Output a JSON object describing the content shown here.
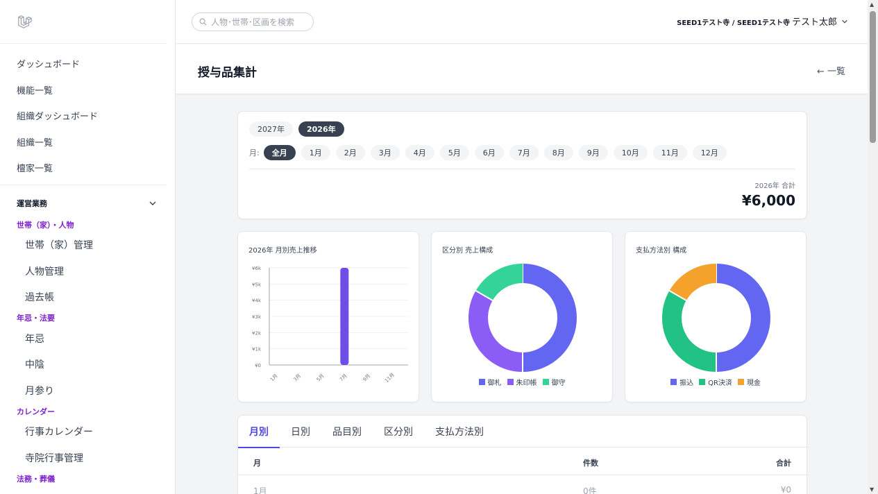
{
  "sidebar": {
    "items": [
      "ダッシュボード",
      "機能一覧",
      "組織ダッシュボード",
      "組織一覧",
      "檀家一覧"
    ],
    "group": "運営業務",
    "sections": [
      {
        "title": "世帯（家）・人物",
        "items": [
          "世帯（家）管理",
          "人物管理",
          "過去帳"
        ]
      },
      {
        "title": "年忌・法要",
        "items": [
          "年忌",
          "中陰",
          "月参り"
        ]
      },
      {
        "title": "カレンダー",
        "items": [
          "行事カレンダー",
          "寺院行事管理"
        ]
      },
      {
        "title": "法務・葬儀",
        "items": []
      }
    ]
  },
  "topbar": {
    "search_placeholder": "人物･世帯･区画を検索",
    "org": "SEED1テスト寺 / SEED1テスト寺",
    "user": "テスト太郎"
  },
  "page": {
    "title": "授与品集計",
    "back": "← 一覧"
  },
  "filters": {
    "years": [
      "2027年",
      "2026年"
    ],
    "active_year": "2026年",
    "month_label": "月:",
    "months": [
      "全月",
      "1月",
      "2月",
      "3月",
      "4月",
      "5月",
      "6月",
      "7月",
      "8月",
      "9月",
      "10月",
      "11月",
      "12月"
    ],
    "active_month": "全月"
  },
  "summary": {
    "label": "2026年 合計",
    "value": "¥6,000"
  },
  "chart_data": [
    {
      "type": "bar",
      "title": "2026年 月別売上推移",
      "categories": [
        "1月",
        "2月",
        "3月",
        "4月",
        "5月",
        "6月",
        "7月",
        "8月",
        "9月",
        "10月",
        "11月",
        "12月"
      ],
      "x_tick_labels": [
        "1月",
        "3月",
        "5月",
        "7月",
        "9月",
        "11月"
      ],
      "values": [
        0,
        0,
        0,
        0,
        0,
        0,
        6000,
        0,
        0,
        0,
        0,
        0
      ],
      "y_tick_labels": [
        "¥0",
        "¥1k",
        "¥2k",
        "¥3k",
        "¥4k",
        "¥5k",
        "¥6k"
      ],
      "ylim": [
        0,
        6000
      ],
      "color": "#6d4ee6",
      "grid": true
    },
    {
      "type": "pie",
      "title": "区分別 売上構成",
      "labels": [
        "御札",
        "朱印帳",
        "御守"
      ],
      "values": [
        3000,
        2000,
        1000
      ],
      "colors": [
        "#6366f1",
        "#8b5cf6",
        "#34d399"
      ]
    },
    {
      "type": "pie",
      "title": "支払方法別 構成",
      "labels": [
        "振込",
        "QR決済",
        "現金"
      ],
      "values": [
        3000,
        2000,
        1000
      ],
      "colors": [
        "#6366f1",
        "#22c184",
        "#f4a22c"
      ]
    }
  ],
  "table": {
    "tabs": [
      "月別",
      "日別",
      "品目別",
      "区分別",
      "支払方法別"
    ],
    "active_tab": "月別",
    "headers": [
      "月",
      "件数",
      "合計"
    ],
    "rows": [
      [
        "1月",
        "0件",
        "¥0"
      ]
    ]
  }
}
